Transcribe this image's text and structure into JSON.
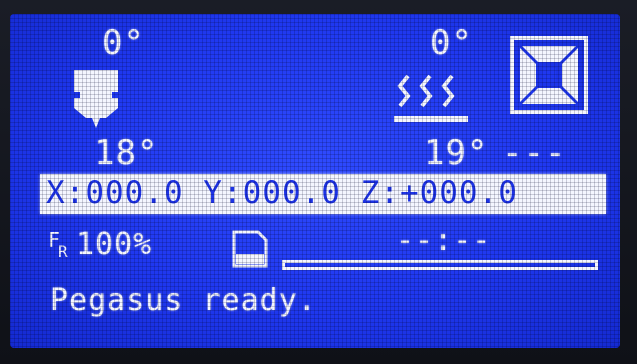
{
  "hotend": {
    "target_temp": "0°",
    "current_temp": "18°",
    "icon": "hotend-nozzle-icon"
  },
  "bed": {
    "target_temp": "0°",
    "current_temp": "19°",
    "icon": "heated-bed-icon"
  },
  "fan": {
    "icon": "fan-icon",
    "speed_text": "---"
  },
  "position": {
    "text": "X:000.0 Y:000.0 Z:+000.0"
  },
  "feedrate": {
    "label_main": "F",
    "label_sub": "R",
    "value": "100%"
  },
  "sd": {
    "icon": "sd-card-icon"
  },
  "print": {
    "elapsed_time": "--:--",
    "progress": 0
  },
  "status": {
    "message": "Pegasus ready."
  },
  "colors": {
    "lcd_background": "#1f38f0",
    "lcd_foreground": "#f4f6ff"
  }
}
